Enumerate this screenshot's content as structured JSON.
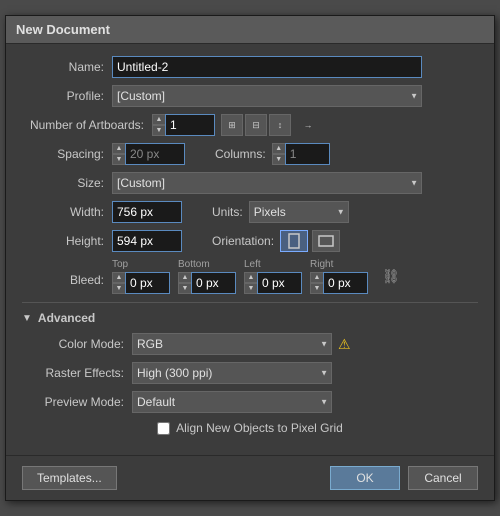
{
  "dialog": {
    "title": "New Document"
  },
  "fields": {
    "name_label": "Name:",
    "name_value": "Untitled-2",
    "profile_label": "Profile:",
    "profile_value": "[Custom]",
    "artboards_label": "Number of Artboards:",
    "artboards_value": "1",
    "spacing_label": "Spacing:",
    "spacing_value": "20 px",
    "columns_label": "Columns:",
    "columns_value": "1",
    "size_label": "Size:",
    "size_value": "[Custom]",
    "width_label": "Width:",
    "width_value": "756 px",
    "units_label": "Units:",
    "units_value": "Pixels",
    "height_label": "Height:",
    "height_value": "594 px",
    "orientation_label": "Orientation:",
    "bleed_label": "Bleed:",
    "bleed_top_label": "Top",
    "bleed_top_value": "0 px",
    "bleed_bottom_label": "Bottom",
    "bleed_bottom_value": "0 px",
    "bleed_left_label": "Left",
    "bleed_left_value": "0 px",
    "bleed_right_label": "Right",
    "bleed_right_value": "0 px",
    "advanced_label": "Advanced",
    "colormode_label": "Color Mode:",
    "colormode_value": "RGB",
    "raster_label": "Raster Effects:",
    "raster_value": "High (300 ppi)",
    "preview_label": "Preview Mode:",
    "preview_value": "Default",
    "align_checkbox_label": "Align New Objects to Pixel Grid",
    "templates_btn": "Templates...",
    "ok_btn": "OK",
    "cancel_btn": "Cancel"
  },
  "icons": {
    "arrow_down": "▼",
    "arrow_right": "▶",
    "spinner_up": "▲",
    "spinner_down": "▼",
    "portrait": "▯",
    "landscape": "▭",
    "warning": "⚠",
    "link": "🔗"
  }
}
